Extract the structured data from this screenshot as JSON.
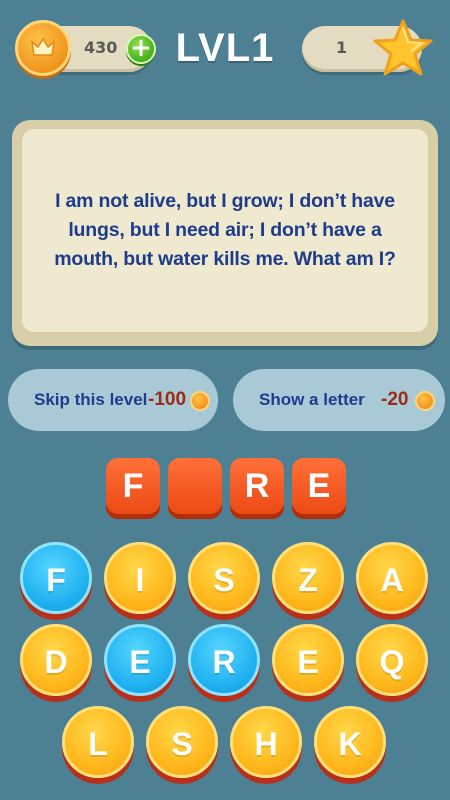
{
  "header": {
    "coins": "430",
    "add_coins_label": "+",
    "level_title": "LVL1",
    "stars": "1"
  },
  "riddle": {
    "text": "I am not alive, but I grow; I don’t have lungs, but I need air; I don’t have a mouth, but water kills me. What am I?"
  },
  "help": {
    "skip_label": "Skip this level",
    "skip_cost": "-100",
    "hint_label": "Show a letter",
    "hint_cost": "-20"
  },
  "answer_slots": [
    "F",
    "",
    "R",
    "E"
  ],
  "keyboard": {
    "keys": [
      {
        "letter": "F",
        "color": "blue"
      },
      {
        "letter": "I",
        "color": "yellow"
      },
      {
        "letter": "S",
        "color": "yellow"
      },
      {
        "letter": "Z",
        "color": "yellow"
      },
      {
        "letter": "A",
        "color": "yellow"
      },
      {
        "letter": "D",
        "color": "yellow"
      },
      {
        "letter": "E",
        "color": "blue"
      },
      {
        "letter": "R",
        "color": "blue"
      },
      {
        "letter": "E",
        "color": "yellow"
      },
      {
        "letter": "Q",
        "color": "yellow"
      },
      {
        "letter": "L",
        "color": "yellow"
      },
      {
        "letter": "S",
        "color": "yellow"
      },
      {
        "letter": "H",
        "color": "yellow"
      },
      {
        "letter": "K",
        "color": "yellow"
      }
    ]
  },
  "colors": {
    "background": "#4e8094",
    "key_yellow": "#ffb81c",
    "key_blue": "#1fb0f0",
    "slot_orange": "#ec4a14",
    "riddle_text": "#1f3c8c"
  }
}
